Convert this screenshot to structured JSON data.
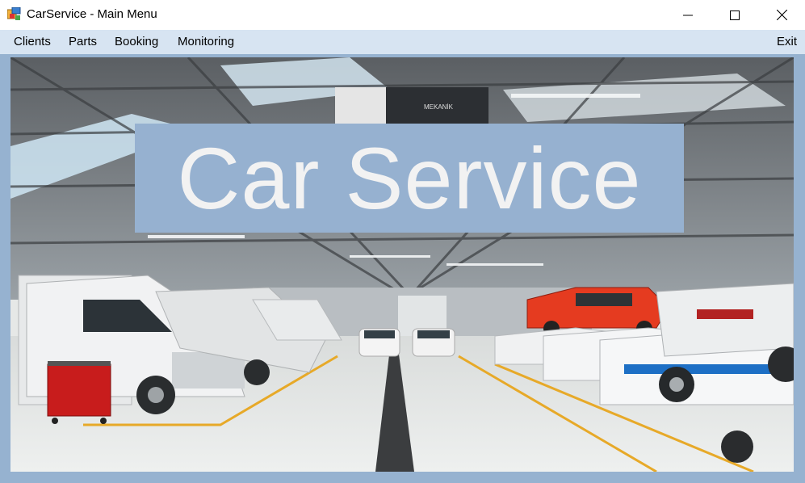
{
  "window": {
    "title": "CarService - Main Menu"
  },
  "menu": {
    "items": [
      {
        "label": "Clients"
      },
      {
        "label": "Parts"
      },
      {
        "label": "Booking"
      },
      {
        "label": "Monitoring"
      }
    ],
    "exit_label": "Exit"
  },
  "banner": {
    "text": "Car Service"
  },
  "background": {
    "sign_text": "MEKANİK"
  },
  "colors": {
    "menubar": "#d7e4f2",
    "frame": "#96b2d0",
    "banner": "#96b1d0",
    "banner_text": "#f2f2f2"
  }
}
